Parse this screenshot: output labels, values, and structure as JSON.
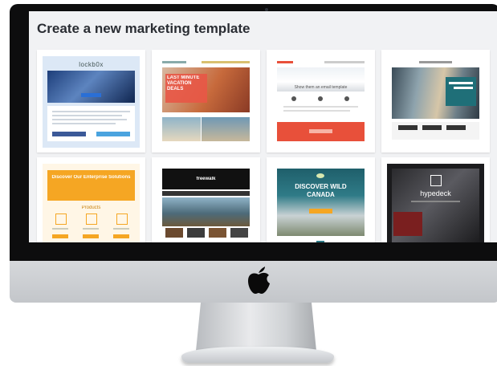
{
  "page": {
    "title": "Create a new marketing template"
  },
  "templates": [
    {
      "label": "lockb0x",
      "headline": "",
      "cta": ""
    },
    {
      "label": "LAST MINUTE VACATION DEALS",
      "headline": "",
      "cta": ""
    },
    {
      "label": "",
      "headline": "Show them an email template",
      "cta": ""
    },
    {
      "label": "",
      "headline": "",
      "cta": ""
    },
    {
      "label": "Discover Our Enterprise Solutions",
      "headline": "Products",
      "cta": ""
    },
    {
      "label": "freewalk",
      "headline": "",
      "cta": ""
    },
    {
      "label": "DISCOVER WILD CANADA",
      "headline": "",
      "cta": ""
    },
    {
      "label": "hypedeck",
      "headline": "",
      "cta": ""
    }
  ],
  "colors": {
    "screen_bg": "#f1f2f4",
    "accent_blue": "#2a6fd6",
    "accent_orange": "#f5a623",
    "accent_red": "#e8503a",
    "accent_teal": "#1f6f78"
  },
  "icons": [
    "apple-logo-icon",
    "camera-icon"
  ]
}
